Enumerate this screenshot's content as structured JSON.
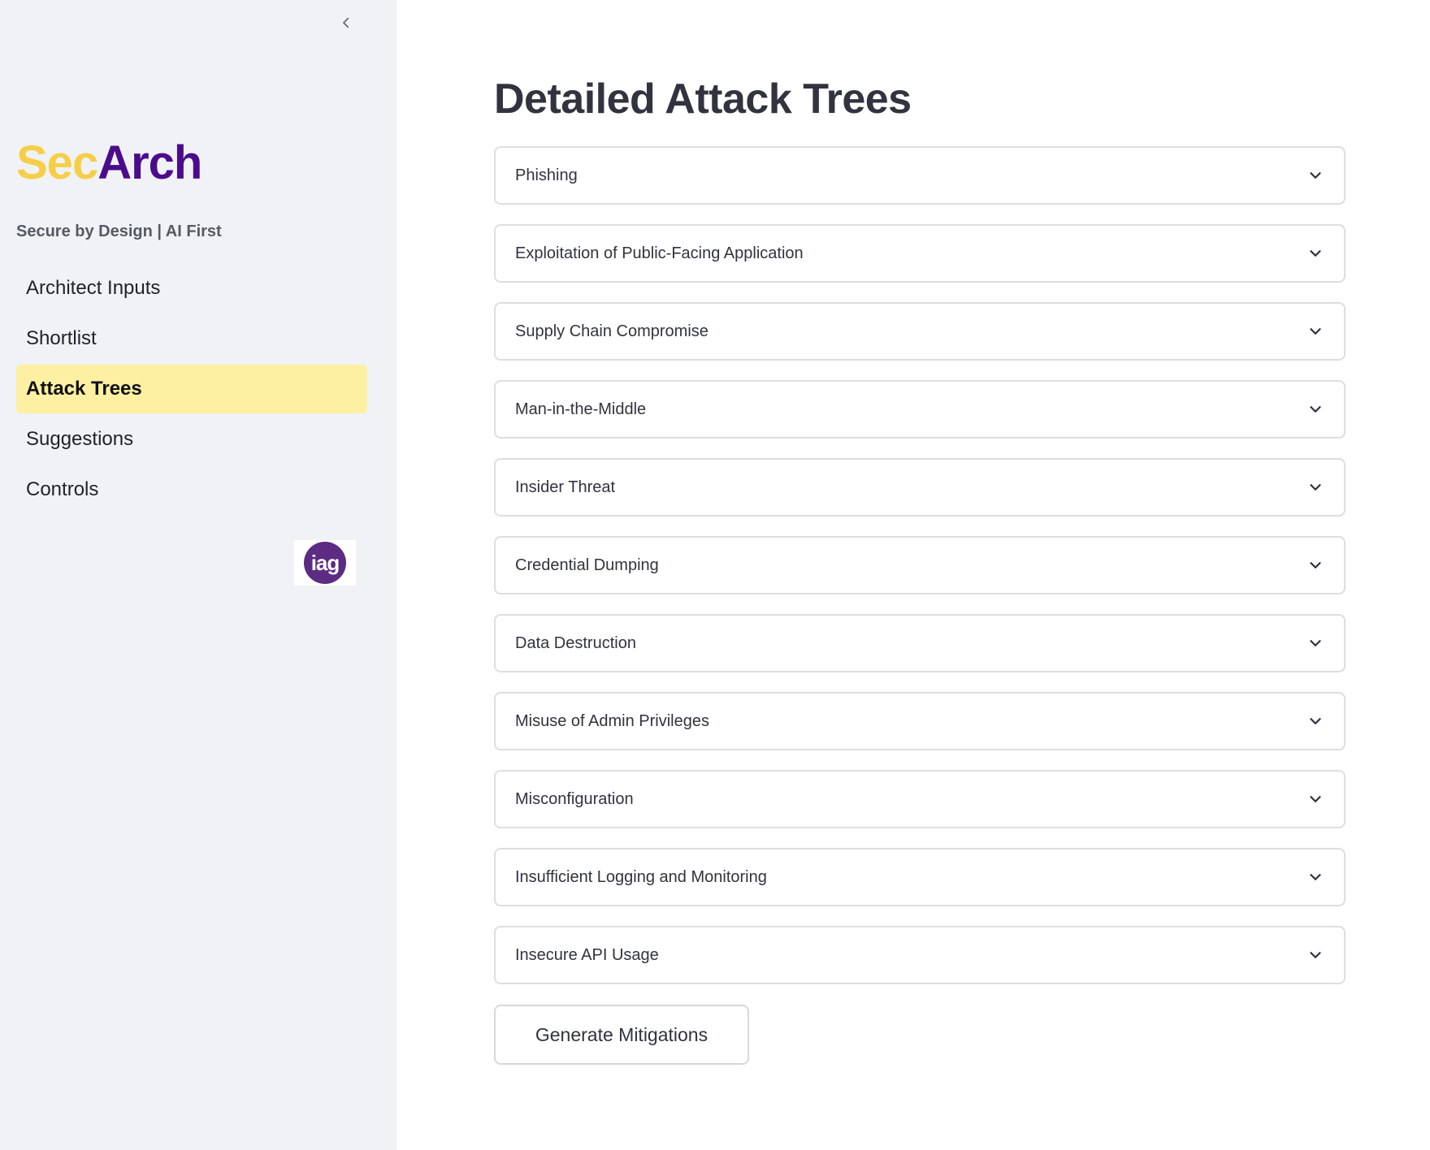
{
  "sidebar": {
    "logo": {
      "part1": "Sec",
      "part2": "Arch"
    },
    "tagline": "Secure by Design | AI First",
    "nav": [
      {
        "label": "Architect Inputs",
        "active": false
      },
      {
        "label": "Shortlist",
        "active": false
      },
      {
        "label": "Attack Trees",
        "active": true
      },
      {
        "label": "Suggestions",
        "active": false
      },
      {
        "label": "Controls",
        "active": false
      }
    ],
    "brand_badge": "iag",
    "collapse_icon": "chevron-left-icon"
  },
  "main": {
    "title": "Detailed Attack Trees",
    "expanders": [
      {
        "label": "Phishing"
      },
      {
        "label": "Exploitation of Public-Facing Application"
      },
      {
        "label": "Supply Chain Compromise"
      },
      {
        "label": "Man-in-the-Middle"
      },
      {
        "label": "Insider Threat"
      },
      {
        "label": "Credential Dumping"
      },
      {
        "label": "Data Destruction"
      },
      {
        "label": "Misuse of Admin Privileges"
      },
      {
        "label": "Misconfiguration"
      },
      {
        "label": "Insufficient Logging and Monitoring"
      },
      {
        "label": "Insecure API Usage"
      }
    ],
    "expander_icon": "chevron-down-icon",
    "generate_button": "Generate Mitigations"
  },
  "colors": {
    "sidebar_bg": "#f0f2f6",
    "active_nav_bg": "#fdf0a3",
    "logo_sec": "#f5cf47",
    "logo_arch": "#4b0c8b",
    "badge": "#5b2c82"
  }
}
